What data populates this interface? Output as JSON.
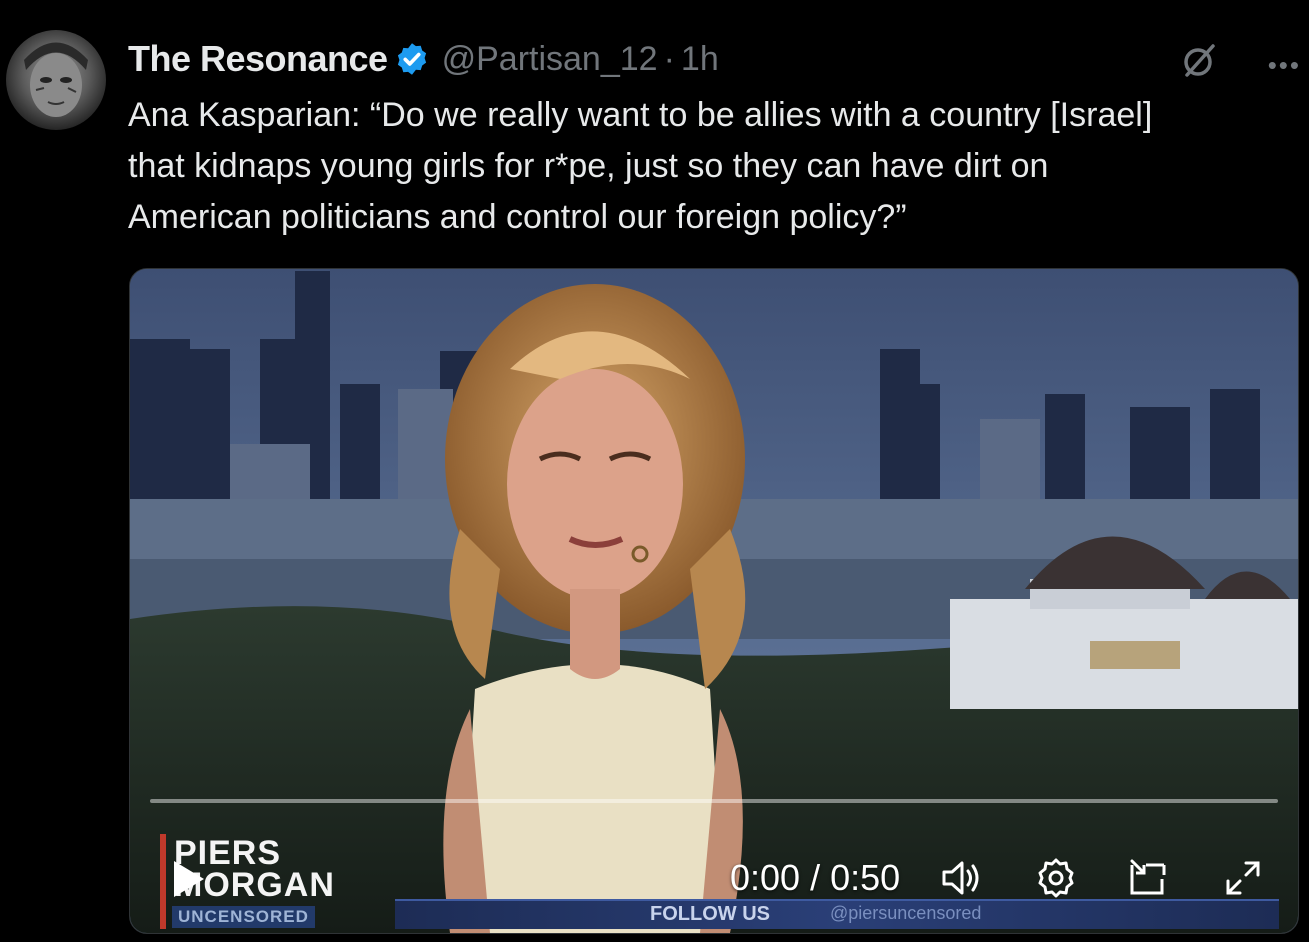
{
  "tweet": {
    "display_name": "The Resonance",
    "handle": "@Partisan_12",
    "separator": "·",
    "time": "1h",
    "text": "Ana Kasparian: “Do we really want to be allies with a country [Israel]\nthat kidnaps young girls for r*pe, just so they can have dirt on\nAmerican politicians and control our foreign policy?”"
  },
  "video": {
    "current_time": "0:00",
    "duration": "0:50",
    "timecode": "0:00 / 0:50",
    "progress": 0.0,
    "logo_line1": "PIERS",
    "logo_line2": "MORGAN",
    "logo_line3": "UNCENSORED",
    "lower_third": "FOLLOW US",
    "lower_third_handle": "@piersuncensored"
  },
  "colors": {
    "background": "#000000",
    "text": "#e7e9ea",
    "muted": "#71767b",
    "verified": "#1d9bf0"
  },
  "icons": {
    "verified": "verified-badge-icon",
    "grok": "grok-icon",
    "more": "more-icon",
    "play": "play-icon",
    "volume": "volume-icon",
    "settings": "gear-icon",
    "pip": "picture-in-picture-icon",
    "fullscreen": "fullscreen-icon"
  }
}
